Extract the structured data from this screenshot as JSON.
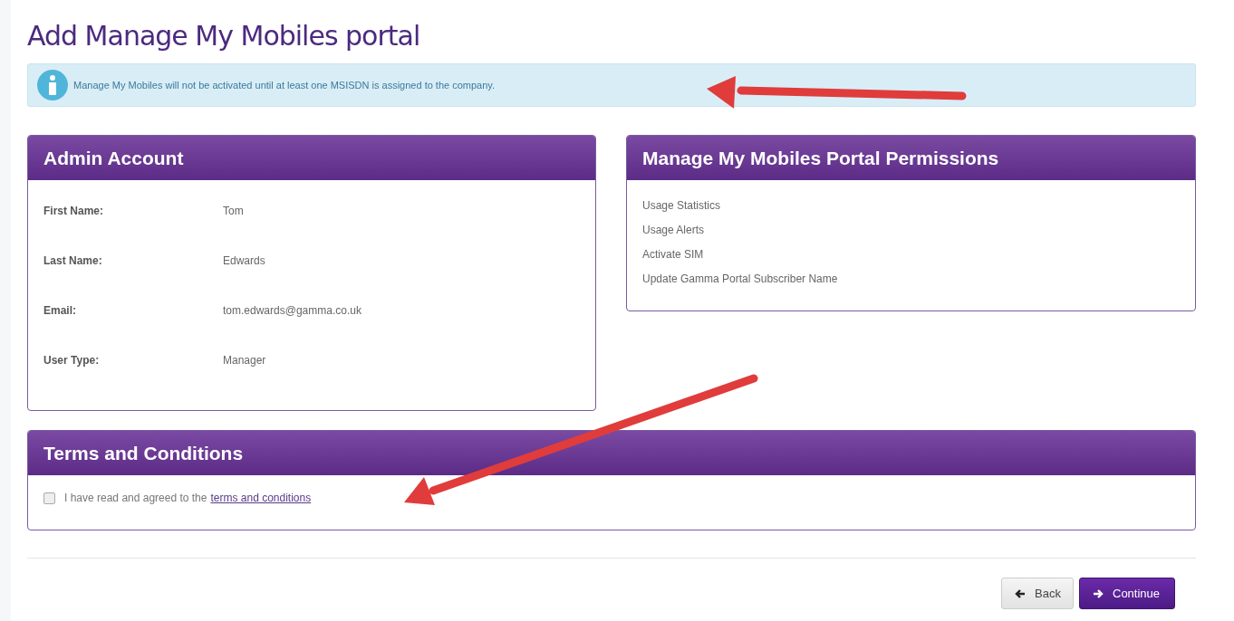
{
  "title": "Add Manage My Mobiles portal",
  "alert": {
    "text": "Manage My Mobiles will not be activated until at least one MSISDN is assigned to the company."
  },
  "admin_account": {
    "heading": "Admin Account",
    "fields": [
      {
        "label": "First Name:",
        "value": "Tom"
      },
      {
        "label": "Last Name:",
        "value": "Edwards"
      },
      {
        "label": "Email:",
        "value": "tom.edwards@gamma.co.uk"
      },
      {
        "label": "User Type:",
        "value": "Manager"
      }
    ]
  },
  "permissions": {
    "heading": "Manage My Mobiles Portal Permissions",
    "items": [
      "Usage Statistics",
      "Usage Alerts",
      "Activate SIM",
      "Update Gamma Portal Subscriber Name"
    ]
  },
  "terms": {
    "heading": "Terms and Conditions",
    "checked": false,
    "text": "I have read and agreed to the",
    "link": "terms and conditions"
  },
  "buttons": [
    {
      "label": "Back",
      "kind": "back"
    },
    {
      "label": "Continue",
      "kind": "continue"
    }
  ]
}
